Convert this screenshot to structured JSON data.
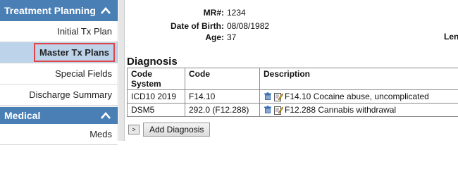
{
  "sidebar": {
    "section1_title": "Treatment Planning",
    "items": [
      {
        "label": "Initial Tx Plan"
      },
      {
        "label": "Master Tx Plans"
      },
      {
        "label": "Special Fields"
      },
      {
        "label": "Discharge Summary"
      }
    ],
    "section2_title": "Medical",
    "section2_items": [
      {
        "label": "Meds"
      }
    ]
  },
  "patient": {
    "mr_label": "MR#:",
    "mr_value": "1234",
    "dob_label": "Date of Birth:",
    "dob_value": "08/08/1982",
    "age_label": "Age:",
    "age_value": "37",
    "cut_label": "Len"
  },
  "diagnosis": {
    "title": "Diagnosis",
    "headers": [
      "Code System",
      "Code",
      "Description"
    ],
    "rows": [
      {
        "system": "ICD10 2019",
        "code": "F14.10",
        "description": "F14.10 Cocaine abuse, uncomplicated"
      },
      {
        "system": "DSM5",
        "code": "292.0 (F12.288)",
        "description": "F12.288 Cannabis withdrawal"
      }
    ],
    "expand_label": ">",
    "add_label": "Add Diagnosis"
  }
}
